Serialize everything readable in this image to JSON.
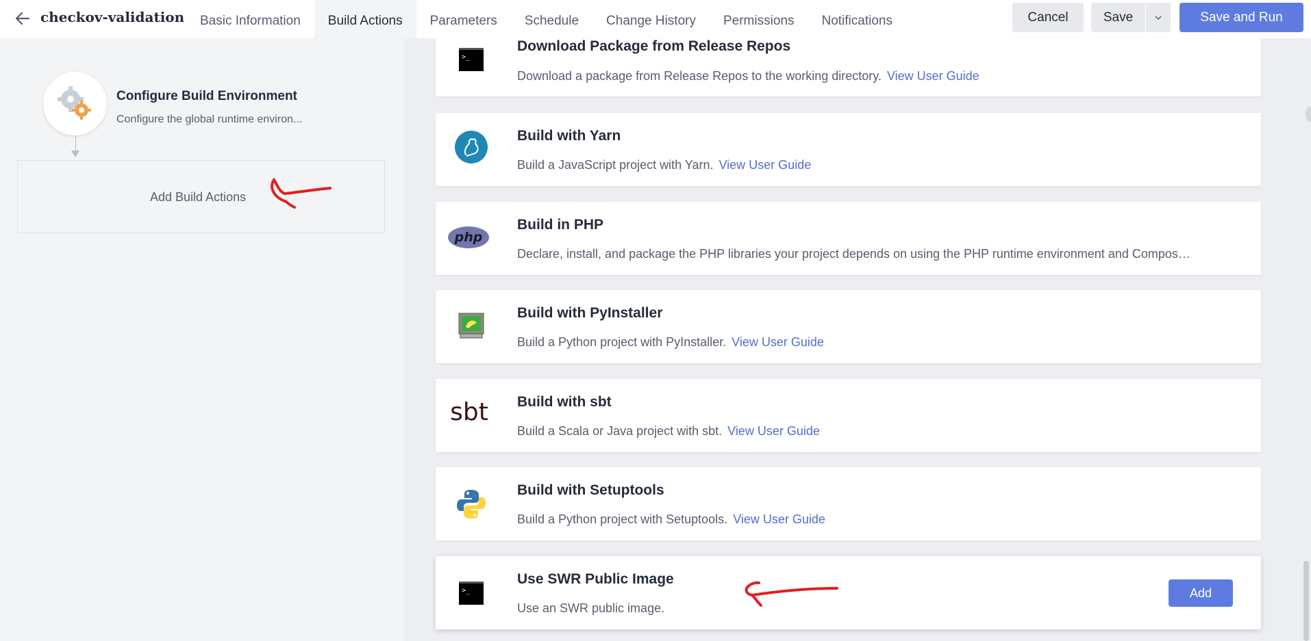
{
  "header": {
    "title": "checkov-validation",
    "tabs": [
      {
        "label": "Basic Information"
      },
      {
        "label": "Build Actions"
      },
      {
        "label": "Parameters"
      },
      {
        "label": "Schedule"
      },
      {
        "label": "Change History"
      },
      {
        "label": "Permissions"
      },
      {
        "label": "Notifications"
      }
    ],
    "active_tab": "Build Actions",
    "cancel_label": "Cancel",
    "save_label": "Save",
    "save_run_label": "Save and Run"
  },
  "left": {
    "env_title": "Configure Build Environment",
    "env_desc": "Configure the global runtime environ...",
    "add_actions_label": "Add Build Actions"
  },
  "actions": [
    {
      "title": "Download Package from Release Repos",
      "desc": "Download a package from Release Repos to the working directory.",
      "guide": "View User Guide",
      "icon": "terminal-icon"
    },
    {
      "title": "Build with Yarn",
      "desc": "Build a JavaScript project with Yarn.",
      "guide": "View User Guide",
      "icon": "yarn-icon"
    },
    {
      "title": "Build in PHP",
      "desc": "Declare, install, and package the PHP libraries your project depends on using the PHP runtime environment and Compos…",
      "guide": "",
      "icon": "php-icon"
    },
    {
      "title": "Build with PyInstaller",
      "desc": "Build a Python project with PyInstaller.",
      "guide": "View User Guide",
      "icon": "pyinstaller-icon"
    },
    {
      "title": "Build with sbt",
      "desc": "Build a Scala or Java project with sbt.",
      "guide": "View User Guide",
      "icon": "sbt-icon"
    },
    {
      "title": "Build with Setuptools",
      "desc": "Build a Python project with Setuptools.",
      "guide": "View User Guide",
      "icon": "python-icon"
    },
    {
      "title": "Use SWR Public Image",
      "desc": "Use an SWR public image.",
      "guide": "",
      "icon": "terminal-icon",
      "add_label": "Add"
    }
  ],
  "icons": {
    "php_text": "php",
    "sbt_text": "sbt"
  },
  "colors": {
    "primary": "#5e7ce0",
    "link": "#526ecc",
    "annotation": "#e02020"
  }
}
